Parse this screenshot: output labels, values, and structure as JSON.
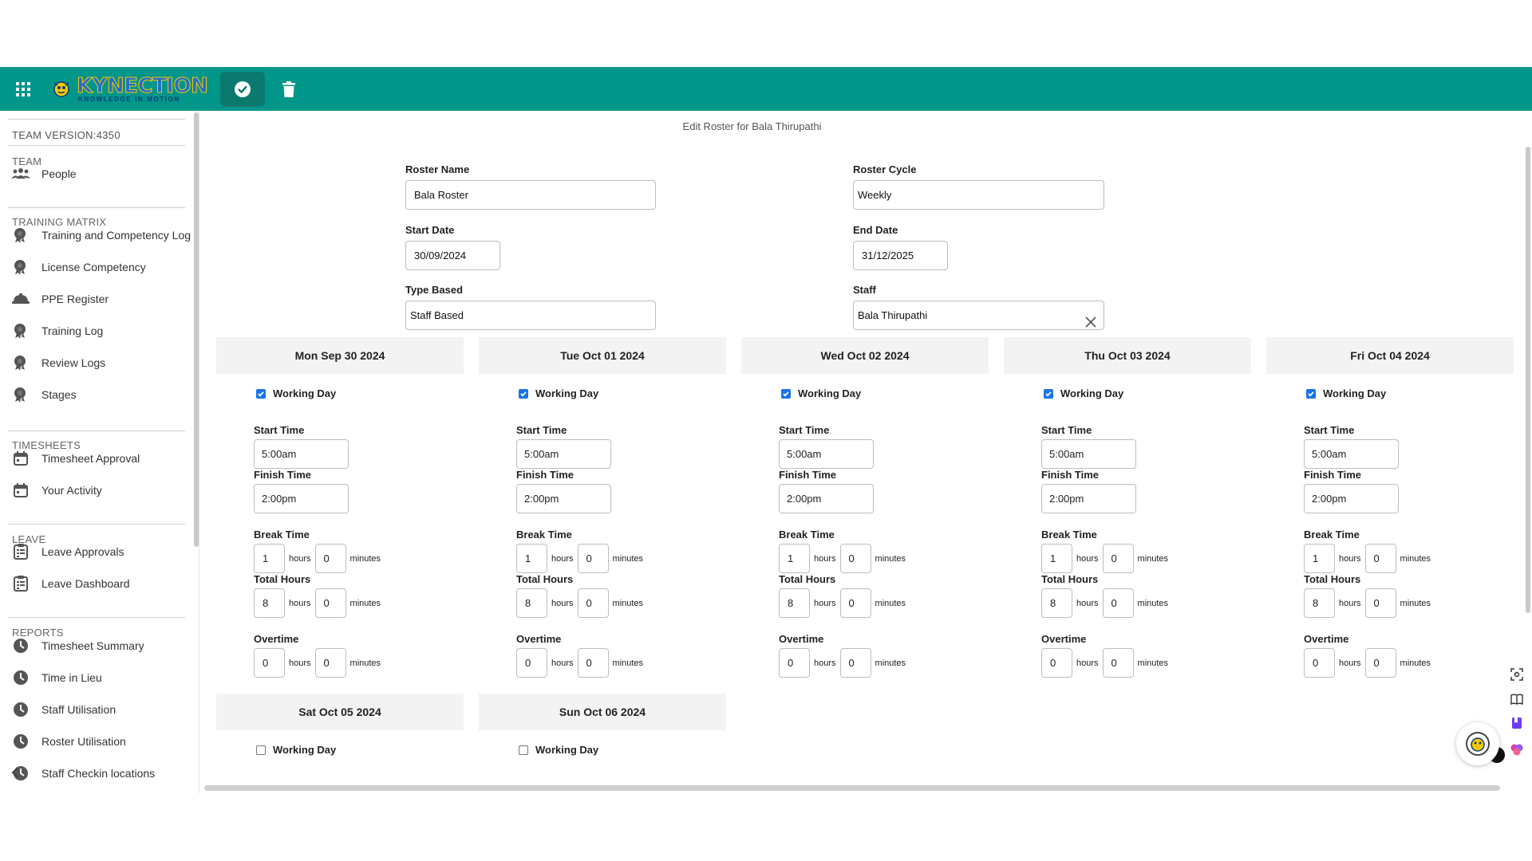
{
  "app": {
    "brand": "KYNECTION",
    "tagline": "KNOWLEDGE IN MOTION"
  },
  "colors": {
    "header": "#00968a",
    "save_button": "#0b7a6e",
    "checkbox": "#1a73e8"
  },
  "toolbar": {
    "save_icon": "check-circle-icon",
    "delete_icon": "trash-icon"
  },
  "sidebar": {
    "version": "TEAM VERSION:4350",
    "sections": [
      {
        "title": "TEAM",
        "items": [
          {
            "label": "People",
            "icon": "people-icon"
          }
        ]
      },
      {
        "title": "TRAINING MATRIX",
        "items": [
          {
            "label": "Training and Competency Log",
            "icon": "badge-icon"
          },
          {
            "label": "License Competency",
            "icon": "badge-icon"
          },
          {
            "label": "PPE Register",
            "icon": "hard-hat-icon"
          },
          {
            "label": "Training Log",
            "icon": "badge-icon"
          },
          {
            "label": "Review Logs",
            "icon": "badge-icon"
          },
          {
            "label": "Stages",
            "icon": "badge-icon"
          }
        ]
      },
      {
        "title": "TIMESHEETS",
        "items": [
          {
            "label": "Timesheet Approval",
            "icon": "calendar-icon"
          },
          {
            "label": "Your Activity",
            "icon": "calendar-icon"
          }
        ]
      },
      {
        "title": "LEAVE",
        "items": [
          {
            "label": "Leave Approvals",
            "icon": "clipboard-icon"
          },
          {
            "label": "Leave Dashboard",
            "icon": "clipboard-icon"
          }
        ]
      },
      {
        "title": "REPORTS",
        "items": [
          {
            "label": "Timesheet Summary",
            "icon": "clock-icon"
          },
          {
            "label": "Time in Lieu",
            "icon": "clock-icon"
          },
          {
            "label": "Staff Utilisation",
            "icon": "clock-icon"
          },
          {
            "label": "Roster Utilisation",
            "icon": "clock-icon"
          },
          {
            "label": "Staff Checkin locations",
            "icon": "clock-icon"
          }
        ]
      }
    ]
  },
  "form": {
    "title": "Edit Roster for Bala Thirupathi",
    "roster_name": {
      "label": "Roster Name",
      "value": "Bala Roster"
    },
    "roster_cycle": {
      "label": "Roster Cycle",
      "value": "Weekly"
    },
    "start_date": {
      "label": "Start Date",
      "value": "30/09/2024"
    },
    "end_date": {
      "label": "End Date",
      "value": "31/12/2025"
    },
    "type_based": {
      "label": "Type Based",
      "value": "Staff Based"
    },
    "staff": {
      "label": "Staff",
      "value": "Bala Thirupathi"
    }
  },
  "labels": {
    "working_day": "Working Day",
    "start_time": "Start Time",
    "finish_time": "Finish Time",
    "break_time": "Break Time",
    "total_hours": "Total Hours",
    "overtime": "Overtime",
    "hours": "hours",
    "minutes": "minutes"
  },
  "days": [
    {
      "date": "Mon Sep 30 2024",
      "working": true,
      "start": "5:00am",
      "finish": "2:00pm",
      "break_h": "1",
      "break_m": "0",
      "total_h": "8",
      "total_m": "0",
      "ot_h": "0",
      "ot_m": "0"
    },
    {
      "date": "Tue Oct 01 2024",
      "working": true,
      "start": "5:00am",
      "finish": "2:00pm",
      "break_h": "1",
      "break_m": "0",
      "total_h": "8",
      "total_m": "0",
      "ot_h": "0",
      "ot_m": "0"
    },
    {
      "date": "Wed Oct 02 2024",
      "working": true,
      "start": "5:00am",
      "finish": "2:00pm",
      "break_h": "1",
      "break_m": "0",
      "total_h": "8",
      "total_m": "0",
      "ot_h": "0",
      "ot_m": "0"
    },
    {
      "date": "Thu Oct 03 2024",
      "working": true,
      "start": "5:00am",
      "finish": "2:00pm",
      "break_h": "1",
      "break_m": "0",
      "total_h": "8",
      "total_m": "0",
      "ot_h": "0",
      "ot_m": "0"
    },
    {
      "date": "Fri Oct 04 2024",
      "working": true,
      "start": "5:00am",
      "finish": "2:00pm",
      "break_h": "1",
      "break_m": "0",
      "total_h": "8",
      "total_m": "0",
      "ot_h": "0",
      "ot_m": "0"
    },
    {
      "date": "Sat Oct 05 2024",
      "working": false
    },
    {
      "date": "Sun Oct 06 2024",
      "working": false
    }
  ]
}
